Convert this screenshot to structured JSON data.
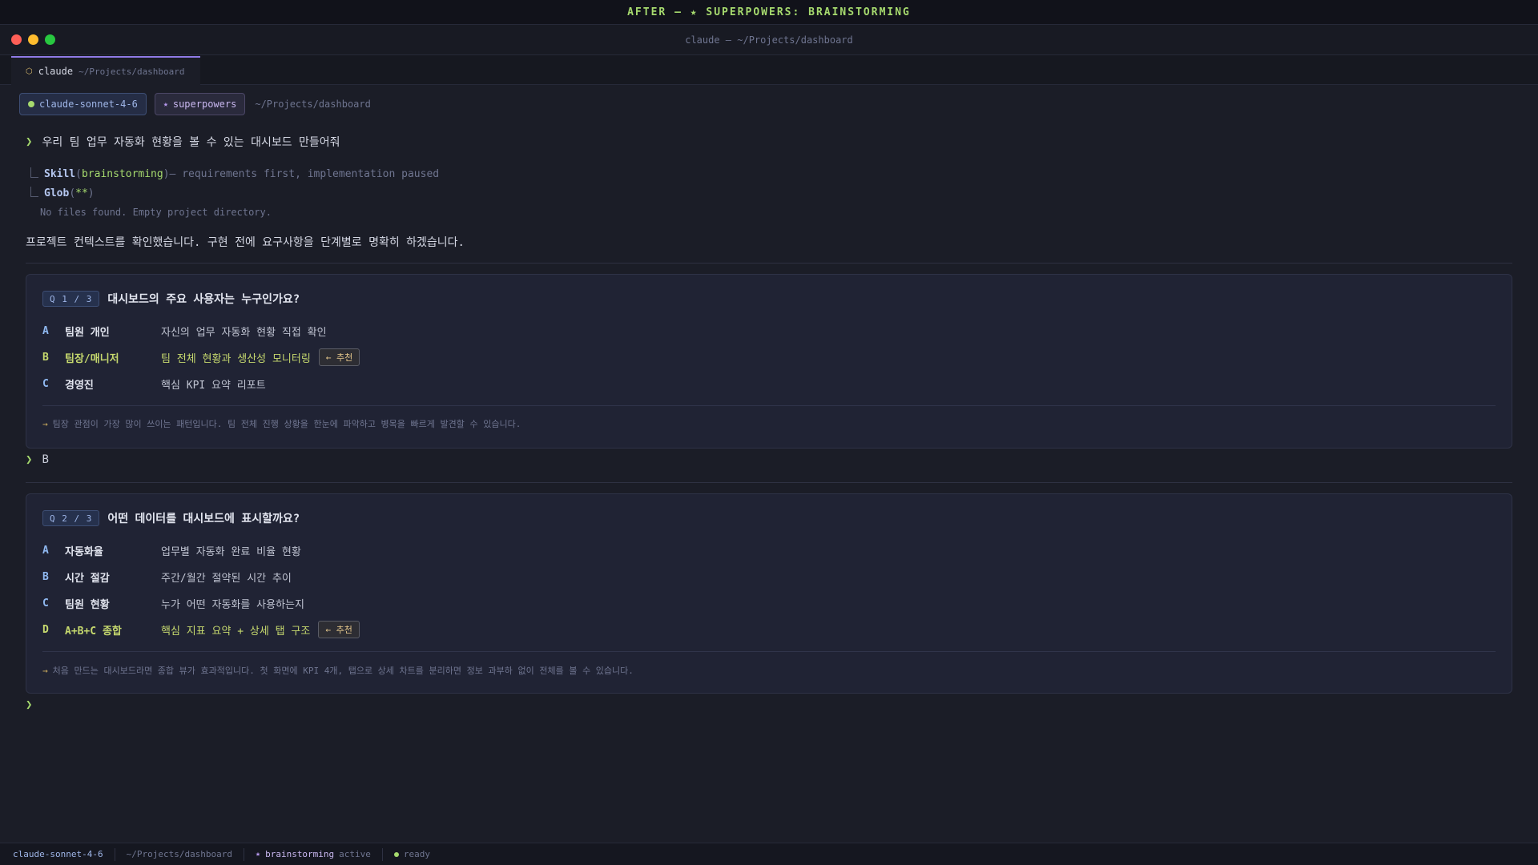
{
  "banner": {
    "text": "AFTER — ★ SUPERPOWERS: BRAINSTORMING"
  },
  "window": {
    "title": "claude — ~/Projects/dashboard"
  },
  "tab": {
    "icon": "hexagon-icon",
    "name": "claude",
    "path": "~/Projects/dashboard"
  },
  "header": {
    "model": "claude-sonnet-4-6",
    "skill": "superpowers",
    "path": "~/Projects/dashboard"
  },
  "prompt": {
    "text": "우리 팀 업무 자동화 현황을 볼 수 있는 대시보드 만들어줘"
  },
  "tools": [
    {
      "name": "Skill",
      "arg": "brainstorming",
      "note": " — requirements first, implementation paused"
    },
    {
      "name": "Glob",
      "arg": "**",
      "note": ""
    }
  ],
  "tool_output": "No files found. Empty project directory.",
  "reply": "프로젝트 컨텍스트를 확인했습니다. 구현 전에 요구사항을 단계별로 명확히 하겠습니다.",
  "q1": {
    "badge": "Q 1 / 3",
    "title": "대시보드의 주요 사용자는 누구인가요?",
    "options": [
      {
        "key": "A",
        "label": "팀원 개인",
        "desc": "자신의 업무 자동화 현황 직접 확인"
      },
      {
        "key": "B",
        "label": "팀장/매니저",
        "desc": "팀 전체 현황과 생산성 모니터링",
        "tag": "← 추천"
      },
      {
        "key": "C",
        "label": "경영진",
        "desc": "핵심 KPI 요약 리포트"
      }
    ],
    "note_arrow": "→",
    "note": "팀장 관점이 가장 많이 쓰이는 패턴입니다. 팀 전체 진행 상황을 한눈에 파악하고 병목을 빠르게 발견할 수 있습니다."
  },
  "answer1": {
    "text": "B"
  },
  "q2": {
    "badge": "Q 2 / 3",
    "title": "어떤 데이터를 대시보드에 표시할까요?",
    "options": [
      {
        "key": "A",
        "label": "자동화율",
        "desc": "업무별 자동화 완료 비율 현황"
      },
      {
        "key": "B",
        "label": "시간 절감",
        "desc": "주간/월간 절약된 시간 추이"
      },
      {
        "key": "C",
        "label": "팀원 현황",
        "desc": "누가 어떤 자동화를 사용하는지"
      },
      {
        "key": "D",
        "label": "A+B+C 종합",
        "desc": "핵심 지표 요약 + 상세 탭 구조",
        "tag": "← 추천"
      }
    ],
    "note_arrow": "→",
    "note": "처음 만드는 대시보드라면 종합 뷰가 효과적입니다. 첫 화면에 KPI 4개, 탭으로 상세 차트를 분리하면 정보 과부하 없이 전체를 볼 수 있습니다."
  },
  "statusbar": {
    "model": "claude-sonnet-4-6",
    "path": "~/Projects/dashboard",
    "skill": "brainstorming",
    "skill_state": "active",
    "status": "ready"
  },
  "colors": {
    "accent": "#a6da6e",
    "recommend": "#c6d96e",
    "tab_accent": "#8f7ae6"
  }
}
